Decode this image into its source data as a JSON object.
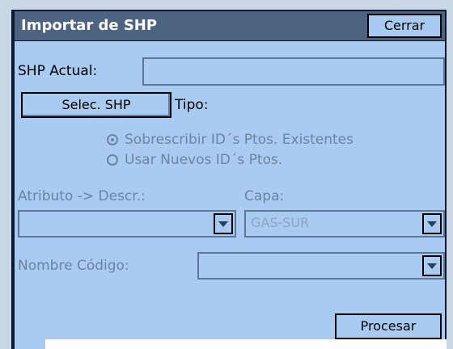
{
  "dialog": {
    "title": "Importar de SHP",
    "close_label": "Cerrar"
  },
  "shp": {
    "label": "SHP Actual:",
    "value": "",
    "select_label": "Selec. SHP",
    "tipo_label": "Tipo:"
  },
  "options": {
    "overwrite_label": "Sobrescribir ID´s Ptos. Existentes",
    "overwrite_checked": true,
    "new_label": "Usar Nuevos ID´s Ptos.",
    "new_checked": false
  },
  "attribute": {
    "label": "Atributo -> Descr.:",
    "value": ""
  },
  "layer": {
    "label": "Capa:",
    "value": "GAS-SUR"
  },
  "code_name": {
    "label": "Nombre Código:",
    "value": ""
  },
  "actions": {
    "process_label": "Procesar"
  },
  "colors": {
    "background": "#a9cbf1",
    "titlebar": "#4c6482",
    "disabled_text": "#6b84a1"
  }
}
